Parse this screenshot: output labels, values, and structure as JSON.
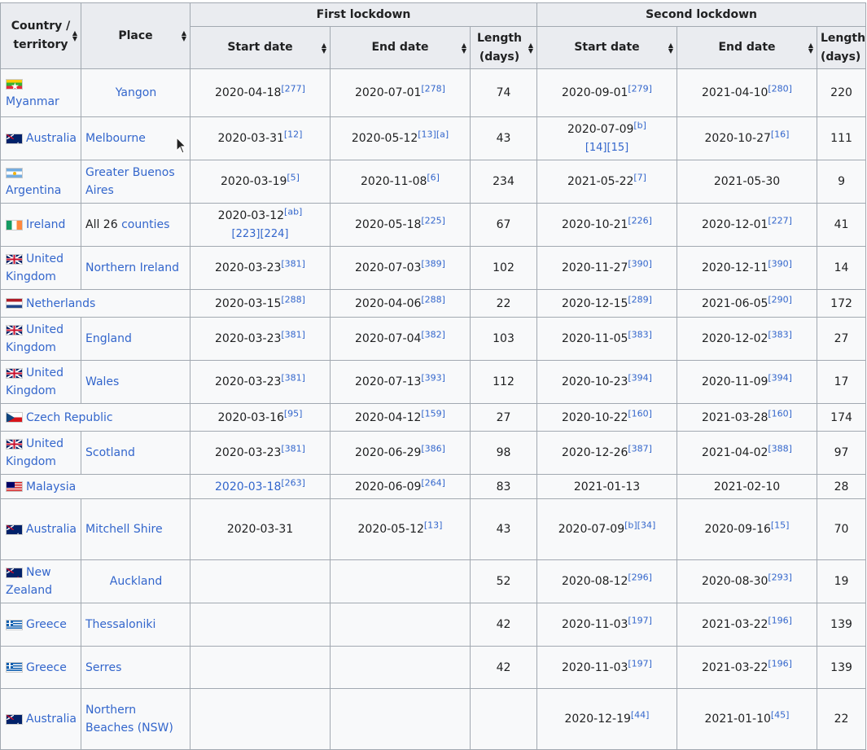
{
  "headers": {
    "country": "Country / territory",
    "place": "Place",
    "first_lockdown": "First lockdown",
    "second_lockdown": "Second lockdown",
    "start_date": "Start date",
    "end_date": "End date",
    "length": "Length (days)",
    "length_cut": "Length (days)"
  },
  "rows": [
    {
      "country": "Myanmar",
      "flag": "mm",
      "place": "Yangon",
      "place_center": true,
      "place_link": true,
      "s1": "2020-04-18",
      "s1_ref": "[277]",
      "e1": "2020-07-01",
      "e1_ref": "[278]",
      "l1": "74",
      "s2": "2020-09-01",
      "s2_ref": "[279]",
      "e2": "2021-04-10",
      "e2_ref": "[280]",
      "l2": "220"
    },
    {
      "country": "Australia",
      "flag": "au",
      "place": "Melbourne",
      "place_link": true,
      "s1": "2020-03-31",
      "s1_ref": "[12]",
      "e1": "2020-05-12",
      "e1_ref": "[13][a]",
      "l1": "43",
      "s2": "2020-07-09",
      "s2_ref": "[b]",
      "s2_ref2": "[14][15]",
      "e2": "2020-10-27",
      "e2_ref": "[16]",
      "l2": "111"
    },
    {
      "country": "Argentina",
      "flag": "ar",
      "place": "Greater Buenos Aires",
      "place_link": true,
      "s1": "2020-03-19",
      "s1_ref": "[5]",
      "e1": "2020-11-08",
      "e1_ref": "[6]",
      "l1": "234",
      "s2": "2021-05-22",
      "s2_ref": "[7]",
      "e2": "2021-05-30",
      "e2_ref": "",
      "l2": "9"
    },
    {
      "country": "Ireland",
      "flag": "ie",
      "place_prefix": "All 26 ",
      "place": "counties",
      "place_link": true,
      "s1": "2020-03-12",
      "s1_ref": "[ab]",
      "s1_ref2": "[223][224]",
      "e1": "2020-05-18",
      "e1_ref": "[225]",
      "l1": "67",
      "s2": "2020-10-21",
      "s2_ref": "[226]",
      "e2": "2020-12-01",
      "e2_ref": "[227]",
      "l2": "41"
    },
    {
      "country": "United Kingdom",
      "flag": "uk",
      "place": "Northern Ireland",
      "place_link": true,
      "s1": "2020-03-23",
      "s1_ref": "[381]",
      "e1": "2020-07-03",
      "e1_ref": "[389]",
      "l1": "102",
      "s2": "2020-11-27",
      "s2_ref": "[390]",
      "e2": "2020-12-11",
      "e2_ref": "[390]",
      "l2": "14"
    },
    {
      "country": "Netherlands",
      "flag": "nl",
      "place": "",
      "colspan": true,
      "s1": "2020-03-15",
      "s1_ref": "[288]",
      "e1": "2020-04-06",
      "e1_ref": "[288]",
      "l1": "22",
      "s2": "2020-12-15",
      "s2_ref": "[289]",
      "e2": "2021-06-05",
      "e2_ref": "[290]",
      "l2": "172"
    },
    {
      "country": "United Kingdom",
      "flag": "uk",
      "place": "England",
      "place_link": true,
      "s1": "2020-03-23",
      "s1_ref": "[381]",
      "e1": "2020-07-04",
      "e1_ref": "[382]",
      "l1": "103",
      "s2": "2020-11-05",
      "s2_ref": "[383]",
      "e2": "2020-12-02",
      "e2_ref": "[383]",
      "l2": "27"
    },
    {
      "country": "United Kingdom",
      "flag": "uk",
      "place": "Wales",
      "place_link": true,
      "s1": "2020-03-23",
      "s1_ref": "[381]",
      "e1": "2020-07-13",
      "e1_ref": "[393]",
      "l1": "112",
      "s2": "2020-10-23",
      "s2_ref": "[394]",
      "e2": "2020-11-09",
      "e2_ref": "[394]",
      "l2": "17"
    },
    {
      "country": "Czech Republic",
      "flag": "cz",
      "place": "",
      "colspan": true,
      "s1": "2020-03-16",
      "s1_ref": "[95]",
      "e1": "2020-04-12",
      "e1_ref": "[159]",
      "l1": "27",
      "s2": "2020-10-22",
      "s2_ref": "[160]",
      "e2": "2021-03-28",
      "e2_ref": "[160]",
      "l2": "174"
    },
    {
      "country": "United Kingdom",
      "flag": "uk",
      "place": "Scotland",
      "place_link": true,
      "s1": "2020-03-23",
      "s1_ref": "[381]",
      "e1": "2020-06-29",
      "e1_ref": "[386]",
      "l1": "98",
      "s2": "2020-12-26",
      "s2_ref": "[387]",
      "e2": "2021-04-02",
      "e2_ref": "[388]",
      "l2": "97"
    },
    {
      "country": "Malaysia",
      "flag": "my",
      "place": "",
      "colspan": true,
      "s1": "2020-03-18",
      "s1_link": true,
      "s1_ref": "[263]",
      "e1": "2020-06-09",
      "e1_ref": "[264]",
      "l1": "83",
      "s2": "2021-01-13",
      "s2_ref": "",
      "e2": "2021-02-10",
      "e2_ref": "",
      "l2": "28"
    },
    {
      "country": "Australia",
      "flag": "au",
      "place": "Mitchell Shire",
      "place_link": true,
      "s1": "2020-03-31",
      "s1_ref": "",
      "e1": "2020-05-12",
      "e1_ref": "[13]",
      "l1": "43",
      "s2": "2020-07-09",
      "s2_ref": "[b][34]",
      "e2": "2020-09-16",
      "e2_ref": "[15]",
      "l2": "70"
    },
    {
      "country": "New Zealand",
      "flag": "nz",
      "place": "Auckland",
      "place_center": true,
      "place_link": true,
      "s1": "",
      "s1_ref": "",
      "e1": "",
      "e1_ref": "",
      "l1": "52",
      "s2": "2020-08-12",
      "s2_ref": "[296]",
      "e2": "2020-08-30",
      "e2_ref": "[293]",
      "l2": "19"
    },
    {
      "country": "Greece",
      "flag": "gr",
      "place": "Thessaloniki",
      "place_link": true,
      "s1": "",
      "s1_ref": "",
      "e1": "",
      "e1_ref": "",
      "l1": "42",
      "s2": "2020-11-03",
      "s2_ref": "[197]",
      "e2": "2021-03-22",
      "e2_ref": "[196]",
      "l2": "139"
    },
    {
      "country": "Greece",
      "flag": "gr",
      "place": "Serres",
      "place_link": true,
      "s1": "",
      "s1_ref": "",
      "e1": "",
      "e1_ref": "",
      "l1": "42",
      "s2": "2020-11-03",
      "s2_ref": "[197]",
      "e2": "2021-03-22",
      "e2_ref": "[196]",
      "l2": "139"
    },
    {
      "country": "Australia",
      "flag": "au",
      "place": "Northern Beaches (NSW)",
      "place_link": true,
      "s1": "",
      "s1_ref": "",
      "e1": "",
      "e1_ref": "",
      "l1": "",
      "s2": "2020-12-19",
      "s2_ref": "[44]",
      "e2": "2021-01-10",
      "e2_ref": "[45]",
      "l2": "22"
    }
  ]
}
